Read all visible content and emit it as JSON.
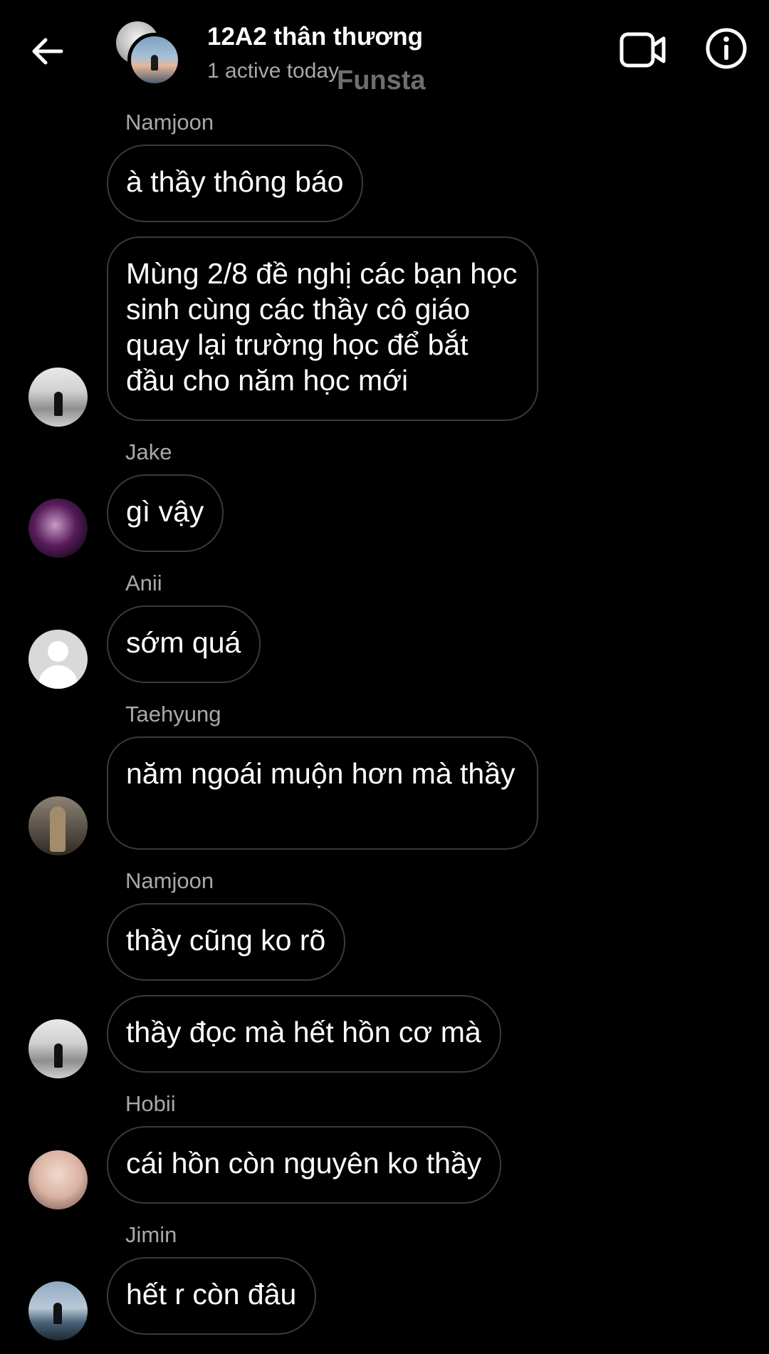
{
  "header": {
    "title": "12A2 thân thương",
    "subtitle": "1 active today",
    "watermark": "Funsta",
    "icons": {
      "back": "arrow-left-icon",
      "video": "video-camera-icon",
      "info": "info-icon"
    }
  },
  "messages": [
    {
      "sender": "Namjoon",
      "text": "à thầy thông báo"
    },
    {
      "sender": "",
      "text": "Mùng 2/8 đề nghị các bạn học sinh cùng các thầy cô giáo quay lại trường học để bắt đầu cho năm học mới"
    },
    {
      "sender": "Jake",
      "text": "gì vậy"
    },
    {
      "sender": "Anii",
      "text": "sớm quá"
    },
    {
      "sender": "Taehyung",
      "text": "năm ngoái muộn hơn mà thầy"
    },
    {
      "sender": "Namjoon",
      "text": "thầy cũng ko rõ"
    },
    {
      "sender": "",
      "text": "thầy đọc mà hết hồn cơ mà"
    },
    {
      "sender": "Hobii",
      "text": "cái hồn còn nguyên ko thầy"
    },
    {
      "sender": "Jimin",
      "text": "hết r còn đâu"
    }
  ],
  "colors": {
    "background": "#000000",
    "bubble_border": "#3a3a3a",
    "secondary_text": "#a8a8a8"
  }
}
